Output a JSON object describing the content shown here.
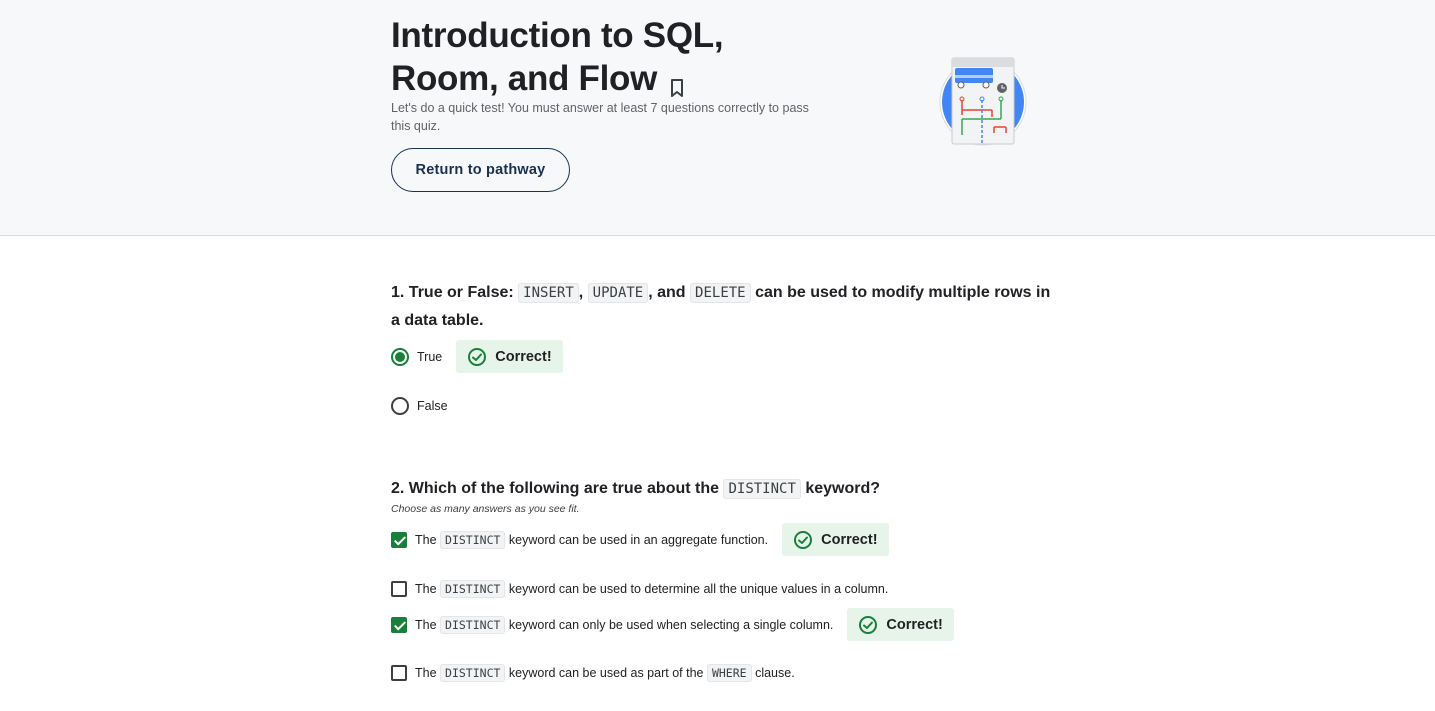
{
  "header": {
    "title": "Introduction to SQL, Room, and Flow",
    "subtitle": "Let's do a quick test! You must answer at least 7 questions correctly to pass this quiz.",
    "return_button": "Return to pathway"
  },
  "q1": {
    "number": "1.",
    "lead": "True or False:",
    "code1": "INSERT",
    "sep1": ",",
    "code2": "UPDATE",
    "sep2": ", and",
    "code3": "DELETE",
    "tail": "can be used to modify multiple rows in a data table.",
    "options": [
      {
        "label": "True",
        "checked": true,
        "feedback": "Correct!"
      },
      {
        "label": "False",
        "checked": false
      }
    ]
  },
  "q2": {
    "number": "2.",
    "lead": "Which of the following are true about the",
    "code": "DISTINCT",
    "tail": "keyword?",
    "hint": "Choose as many answers as you see fit.",
    "options": [
      {
        "pre": "The",
        "code": "DISTINCT",
        "post": "keyword can be used in an aggregate function.",
        "checked": true,
        "feedback": "Correct!"
      },
      {
        "pre": "The",
        "code": "DISTINCT",
        "post": "keyword can be used to determine all the unique values in a column.",
        "checked": false
      },
      {
        "pre": "The",
        "code": "DISTINCT",
        "post": "keyword can only be used when selecting a single column.",
        "checked": true,
        "feedback": "Correct!"
      },
      {
        "pre": "The",
        "code": "DISTINCT",
        "post": "keyword can be used as part of the",
        "code2": "WHERE",
        "post2": "clause.",
        "checked": false
      }
    ]
  },
  "colors": {
    "correct_green": "#188038",
    "feedback_bg": "#e6f4ea",
    "header_bg": "#f7f8fa",
    "button_border": "#1a3050"
  }
}
